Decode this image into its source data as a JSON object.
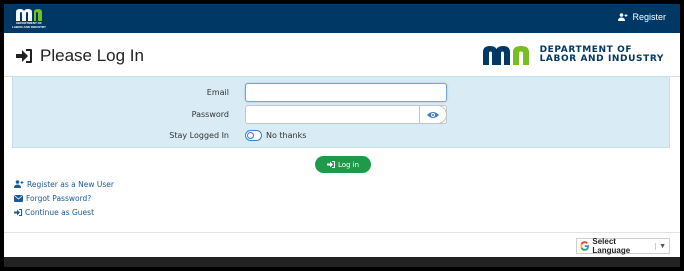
{
  "topbar": {
    "logo_text": "DEPARTMENT OF LABOR AND INDUSTRY",
    "register_label": "Register"
  },
  "header": {
    "title": "Please Log In",
    "brand_line1": "DEPARTMENT OF",
    "brand_line2": "LABOR AND INDUSTRY"
  },
  "form": {
    "email_label": "Email",
    "email_value": "",
    "password_label": "Password",
    "password_value": "",
    "stay_logged_label": "Stay Logged In",
    "toggle_text": "No thanks",
    "submit_label": "Log in"
  },
  "links": {
    "register": "Register as a New User",
    "forgot": "Forgot Password?",
    "guest": "Continue as Guest"
  },
  "footer": {
    "language_label": "Select Language"
  },
  "colors": {
    "brand_navy": "#003865",
    "form_bg": "#d9ebf5",
    "login_green": "#1f9a48",
    "link_blue": "#1a5a96"
  }
}
